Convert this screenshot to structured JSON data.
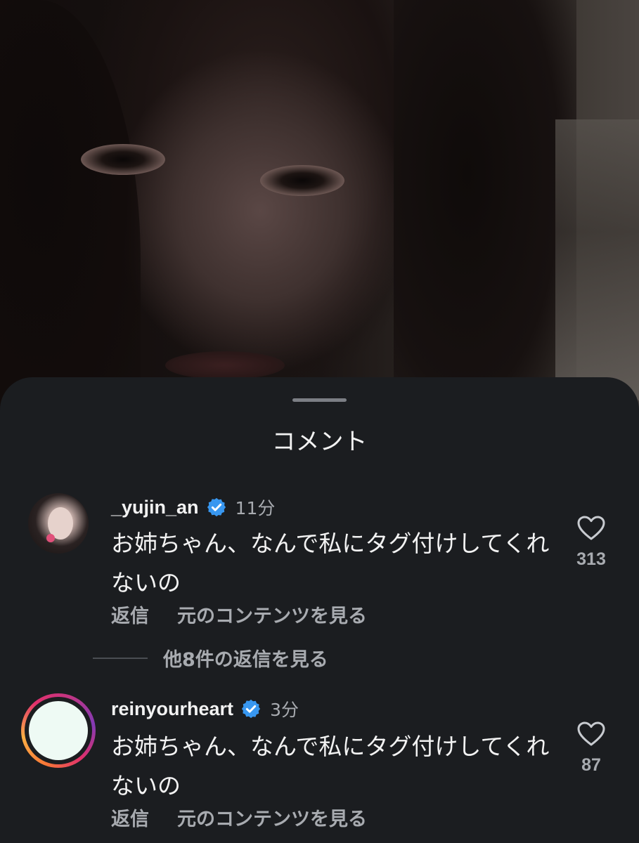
{
  "sheet": {
    "title": "コメント"
  },
  "comments": [
    {
      "username": "_yujin_an",
      "verified": true,
      "time": "11分",
      "text": "お姉ちゃん、なんで私にタグ付けしてくれないの",
      "reply_label": "返信",
      "view_original_label": "元のコンテンツを見る",
      "like_count": "313",
      "like_icon": "heart-outline-icon"
    },
    {
      "username": "reinyourheart",
      "verified": true,
      "time": "3分",
      "text": "お姉ちゃん、なんで私にタグ付けしてくれないの",
      "reply_label": "返信",
      "view_original_label": "元のコンテンツを見る",
      "like_count": "87",
      "like_icon": "heart-outline-icon"
    }
  ],
  "replies_toggle": {
    "label": "他8件の返信を見る"
  },
  "colors": {
    "sheet_bg": "#1b1d20",
    "primary_text": "#f2f2f2",
    "secondary_text": "#a8abb0",
    "verified_blue": "#3897f0"
  }
}
